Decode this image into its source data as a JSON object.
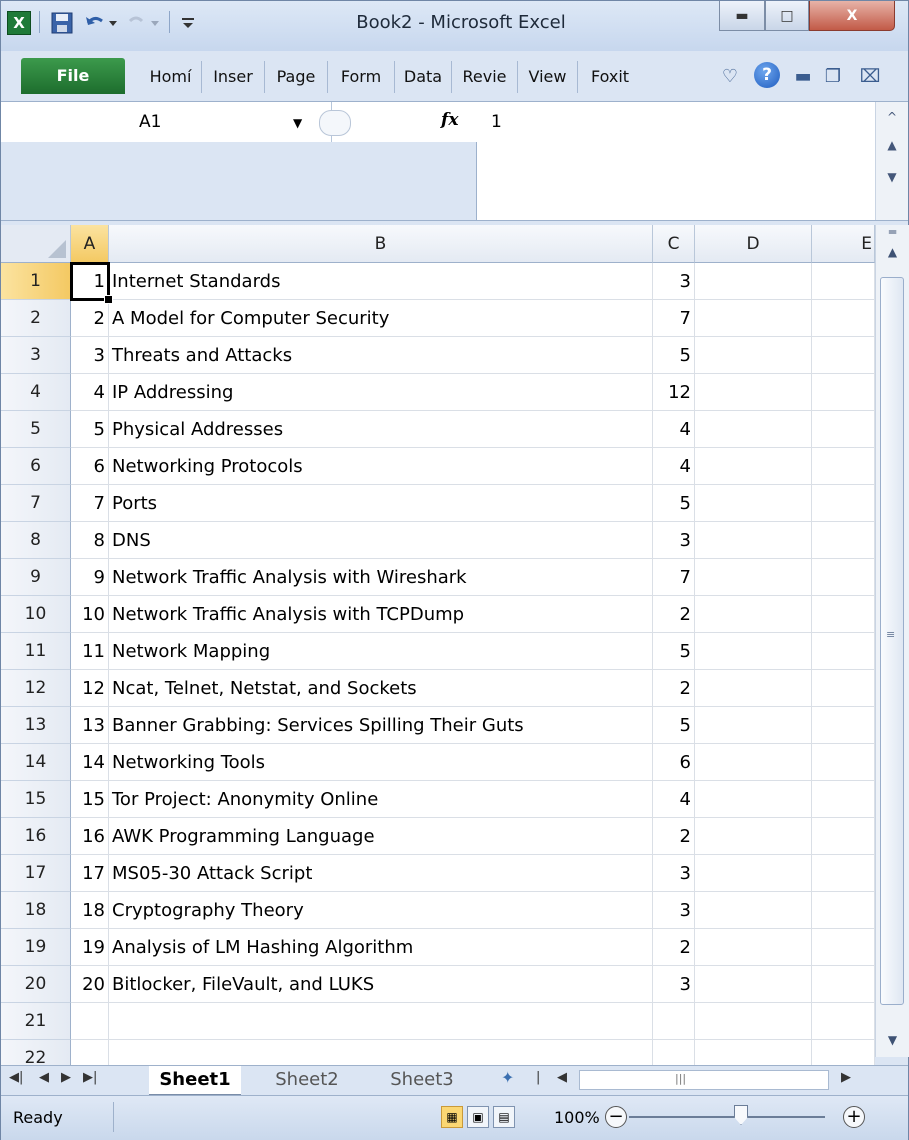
{
  "window": {
    "title": "Book2 - Microsoft Excel"
  },
  "quick_access": {
    "icons": [
      "excel-logo-icon",
      "save-icon",
      "undo-icon",
      "redo-icon",
      "customize-icon"
    ]
  },
  "ribbon": {
    "file_label": "File",
    "tabs": [
      "Homí",
      "Inser",
      "Page",
      "Form",
      "Data",
      "Revie",
      "View",
      "Foxit"
    ]
  },
  "formula_bar": {
    "name_box": "A1",
    "fx_label": "fx",
    "content": "1"
  },
  "grid": {
    "columns": [
      "A",
      "B",
      "C",
      "D",
      "E"
    ],
    "rows": [
      {
        "row": "1",
        "a": "1",
        "b": "Internet Standards",
        "c": "3"
      },
      {
        "row": "2",
        "a": "2",
        "b": "A Model for Computer Security",
        "c": "7"
      },
      {
        "row": "3",
        "a": "3",
        "b": "Threats and Attacks",
        "c": "5"
      },
      {
        "row": "4",
        "a": "4",
        "b": "IP Addressing",
        "c": "12"
      },
      {
        "row": "5",
        "a": "5",
        "b": "Physical Addresses",
        "c": "4"
      },
      {
        "row": "6",
        "a": "6",
        "b": "Networking Protocols",
        "c": "4"
      },
      {
        "row": "7",
        "a": "7",
        "b": "Ports",
        "c": "5"
      },
      {
        "row": "8",
        "a": "8",
        "b": "DNS",
        "c": "3"
      },
      {
        "row": "9",
        "a": "9",
        "b": "Network Traffic Analysis with Wireshark",
        "c": "7"
      },
      {
        "row": "10",
        "a": "10",
        "b": "Network Traffic Analysis with TCPDump",
        "c": "2"
      },
      {
        "row": "11",
        "a": "11",
        "b": "Network Mapping",
        "c": "5"
      },
      {
        "row": "12",
        "a": "12",
        "b": "Ncat, Telnet, Netstat, and Sockets",
        "c": "2"
      },
      {
        "row": "13",
        "a": "13",
        "b": " Banner Grabbing: Services Spilling Their Guts",
        "c": "5"
      },
      {
        "row": "14",
        "a": "14",
        "b": "Networking Tools",
        "c": "6"
      },
      {
        "row": "15",
        "a": "15",
        "b": "Tor Project: Anonymity Online",
        "c": "4"
      },
      {
        "row": "16",
        "a": "16",
        "b": "AWK Programming Language",
        "c": "2"
      },
      {
        "row": "17",
        "a": "17",
        "b": "MS05-30 Attack Script",
        "c": "3"
      },
      {
        "row": "18",
        "a": "18",
        "b": "Cryptography Theory",
        "c": "3"
      },
      {
        "row": "19",
        "a": "19",
        "b": "Analysis of LM Hashing Algorithm",
        "c": "2"
      },
      {
        "row": "20",
        "a": "20",
        "b": "Bitlocker, FileVault, and LUKS",
        "c": "3"
      },
      {
        "row": "21",
        "a": "",
        "b": "",
        "c": ""
      },
      {
        "row": "22",
        "a": "",
        "b": "",
        "c": ""
      }
    ]
  },
  "sheets": {
    "tabs": [
      "Sheet1",
      "Sheet2",
      "Sheet3"
    ],
    "active": "Sheet1"
  },
  "status": {
    "ready": "Ready",
    "zoom": "100%"
  }
}
